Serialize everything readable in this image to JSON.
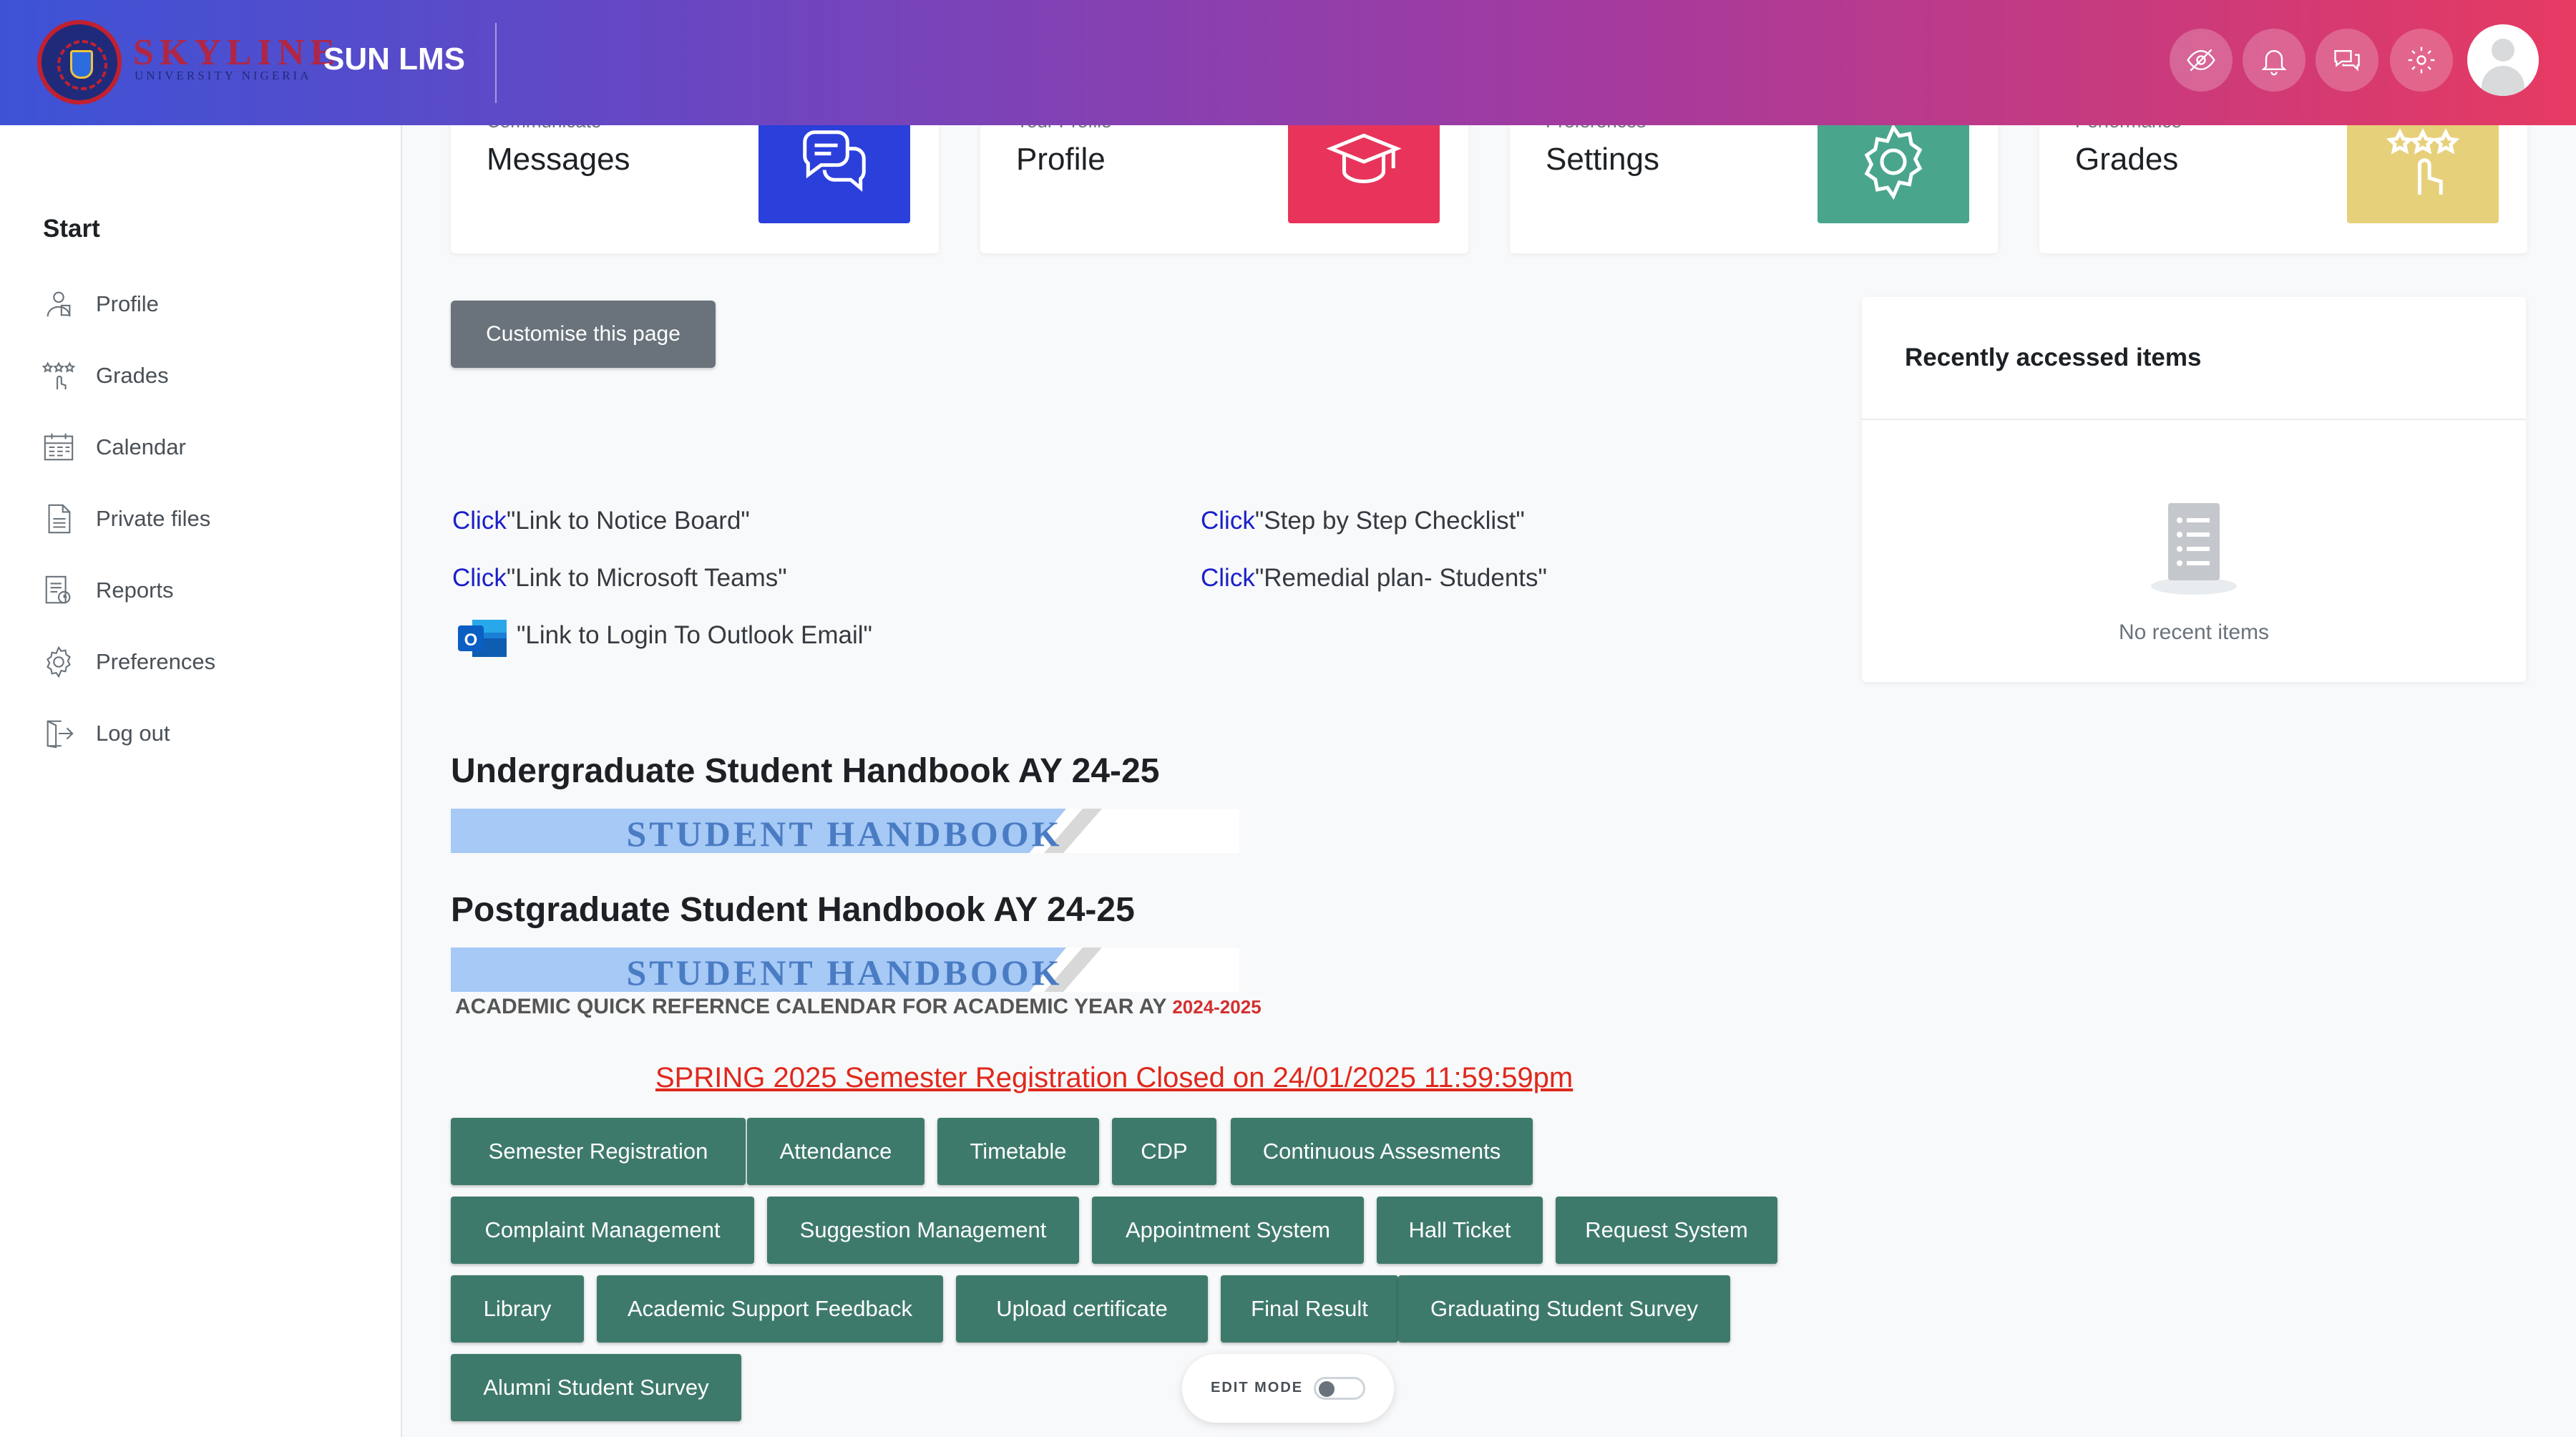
{
  "header": {
    "logo_text": "SKYLINE",
    "logo_subtext": "UNIVERSITY NIGERIA",
    "site_name": "SUN LMS",
    "icons": [
      "hide-icon",
      "notifications-icon",
      "messages-icon",
      "settings-icon"
    ]
  },
  "sidebar": {
    "heading": "Start",
    "items": [
      {
        "label": "Profile",
        "icon": "profile-icon"
      },
      {
        "label": "Grades",
        "icon": "grades-icon"
      },
      {
        "label": "Calendar",
        "icon": "calendar-icon"
      },
      {
        "label": "Private files",
        "icon": "file-icon"
      },
      {
        "label": "Reports",
        "icon": "reports-icon"
      },
      {
        "label": "Preferences",
        "icon": "gear-icon"
      },
      {
        "label": "Log out",
        "icon": "logout-icon"
      }
    ]
  },
  "cards": [
    {
      "subtitle": "Communicate",
      "title": "Messages",
      "color": "#2b3fdb",
      "icon": "chat-icon"
    },
    {
      "subtitle": "Your Profile",
      "title": "Profile",
      "color": "#e8345a",
      "icon": "graduation-cap-icon"
    },
    {
      "subtitle": "Preferences",
      "title": "Settings",
      "color": "#4aa58d",
      "icon": "gear-icon"
    },
    {
      "subtitle": "Performance",
      "title": "Grades",
      "color": "#e6d07a",
      "icon": "stars-hand-icon"
    }
  ],
  "main": {
    "customise_label": "Customise this page",
    "links": [
      {
        "click": "Click",
        "text": "\"Link to Notice Board\""
      },
      {
        "click": "Click",
        "text": "\"Link to Microsoft Teams\""
      },
      {
        "click": "",
        "text": "\"Link to Login To Outlook Email\""
      },
      {
        "click": "Click",
        "text": "\"Step by Step Checklist\""
      },
      {
        "click": "Click",
        "text": "\"Remedial plan- Students\""
      }
    ],
    "undergrad_title": "Undergraduate Student Handbook AY 24-25",
    "postgrad_title": "Postgraduate Student Handbook AY 24-25",
    "banner_text": "STUDENT HANDBOOK",
    "calendar_text": "ACADEMIC QUICK REFERNCE CALENDAR FOR ACADEMIC YEAR AY",
    "calendar_year": "2024-2025",
    "registration_notice": "SPRING 2025 Semester Registration Closed on 24/01/2025 11:59:59pm",
    "quick_buttons": [
      [
        "Semester Registration",
        "Attendance",
        "Timetable",
        "CDP",
        "Continuous Assesments"
      ],
      [
        "Complaint Management",
        "Suggestion Management",
        "Appointment System",
        "Hall Ticket",
        "Request System"
      ],
      [
        "Library",
        "Academic Support Feedback",
        "Upload certificate",
        "Final Result",
        "Graduating Student Survey"
      ],
      [
        "Alumni Student Survey"
      ]
    ]
  },
  "recent": {
    "title": "Recently accessed items",
    "empty_text": "No recent items"
  },
  "edit_mode": {
    "label": "EDIT MODE",
    "enabled": false
  }
}
